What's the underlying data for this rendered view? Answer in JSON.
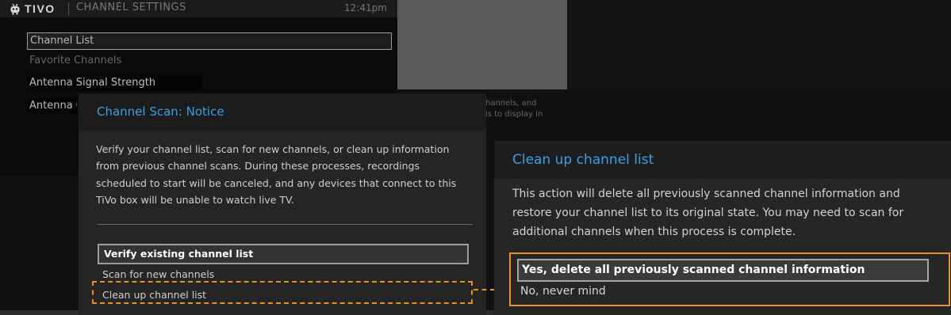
{
  "header": {
    "logo_text": "TIVO",
    "screen_title": "CHANNEL SETTINGS",
    "time": "12:41pm"
  },
  "menu": {
    "items": [
      {
        "label": "Channel List",
        "state": "focused"
      },
      {
        "label": "Favorite Channels",
        "state": "dimmed"
      },
      {
        "label": "Antenna Signal Strength",
        "state": "normal"
      },
      {
        "label": "Antenna C",
        "state": "normal"
      }
    ]
  },
  "background_description_fragment": "hannels, and\nis to display in",
  "notice_dialog": {
    "title": "Channel Scan: Notice",
    "body": "Verify your channel list, scan for new channels, or clean up information from previous channel scans. During these processes, recordings scheduled to start will be canceled, and any devices that connect to this TiVo box will be unable to watch live TV.",
    "options": [
      {
        "label": "Verify existing channel list",
        "selected": true
      },
      {
        "label": "Scan for new channels",
        "selected": false
      },
      {
        "label": "Clean up channel list",
        "selected": false,
        "highlighted": true
      }
    ]
  },
  "cleanup_dialog": {
    "title": "Clean up channel list",
    "body": "This action will delete all previously scanned channel information and restore your channel list to its original state. You may need to scan for additional channels when this process is complete.",
    "options": [
      {
        "label": "Yes, delete all previously scanned channel information",
        "selected": true
      },
      {
        "label": "No, never mind",
        "selected": false
      }
    ]
  },
  "colors": {
    "accent_title": "#3aa0e6",
    "highlight_annotation": "#e8921f"
  },
  "icons": {
    "logo": "tivo-mascot-icon"
  }
}
